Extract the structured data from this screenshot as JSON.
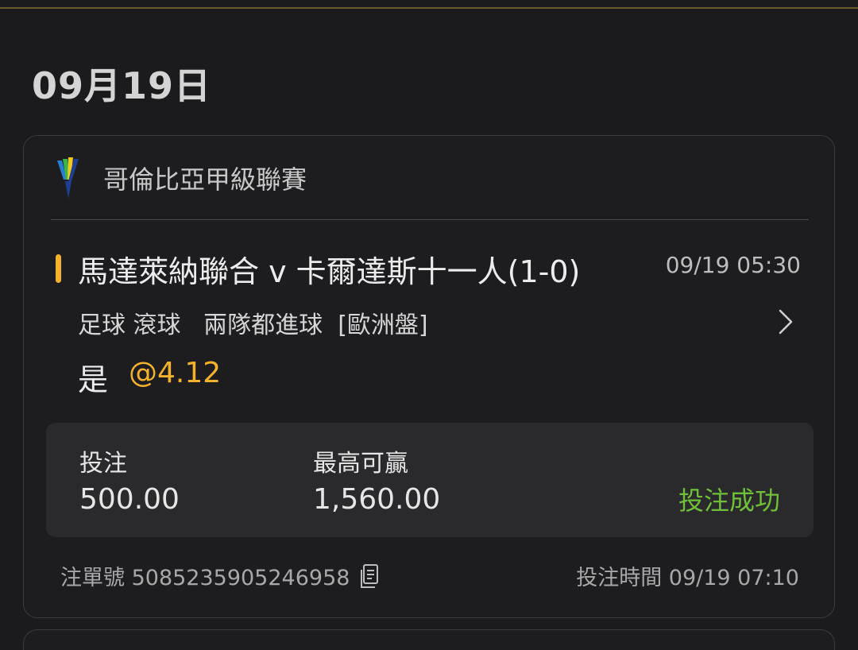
{
  "date": "09月19日",
  "bet": {
    "league": "哥倫比亞甲級聯賽",
    "league_icon": "league-logo-icon",
    "match": "馬達萊納聯合 v 卡爾達斯十一人(1-0)",
    "match_time": "09/19 05:30",
    "market": "足球 滾球   兩隊都進球  [歐洲盤]",
    "selection": "是",
    "odds": "@4.12",
    "stake_label": "投注",
    "stake_value": "500.00",
    "max_win_label": "最高可贏",
    "max_win_value": "1,560.00",
    "status": "投注成功",
    "ticket_no": "注單號 5085235905246958",
    "bet_time": "投注時間 09/19 07:10"
  },
  "colors": {
    "accent": "#f2b22c",
    "success": "#6fbf3a",
    "background": "#1b1b1d",
    "box": "#2a2a2c"
  }
}
